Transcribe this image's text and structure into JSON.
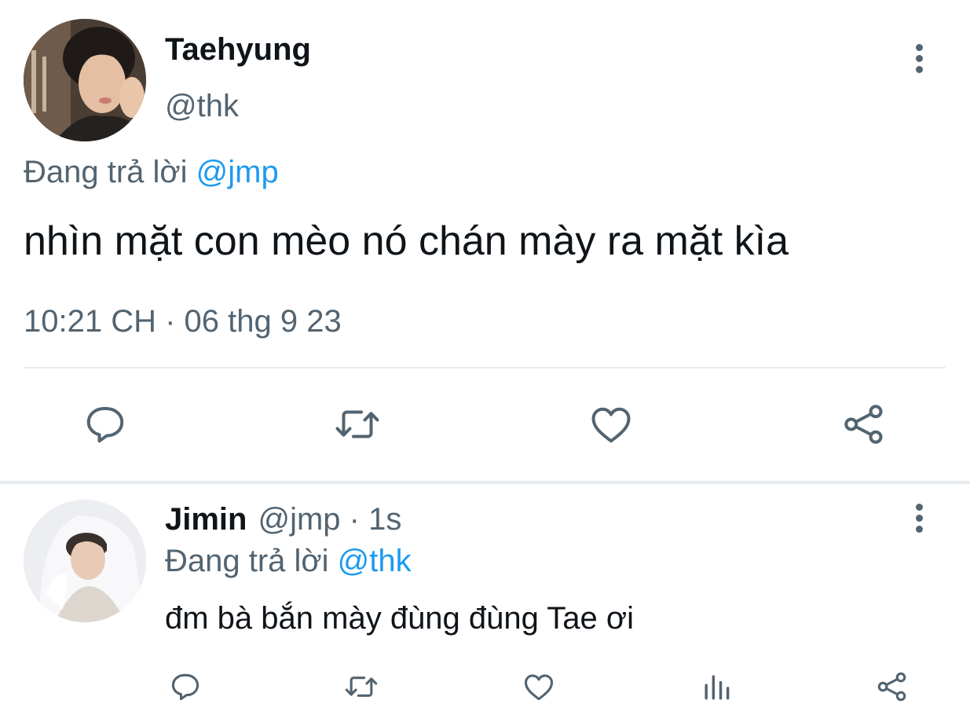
{
  "main_tweet": {
    "display_name": "Taehyung",
    "handle": "@thk",
    "replying_prefix": "Đang trả lời ",
    "replying_to": "@jmp",
    "text": "nhìn mặt con mèo nó chán mày ra mặt kìa",
    "timestamp": "10:21 CH · 06 thg 9 23",
    "icons": {
      "more": "more-vertical-icon",
      "reply": "reply-icon",
      "retweet": "retweet-icon",
      "like": "heart-icon",
      "share": "share-icon"
    }
  },
  "reply_tweet": {
    "display_name": "Jimin",
    "meta": "@jmp · 1s",
    "replying_prefix": "Đang trả lời ",
    "replying_to": "@thk",
    "text": "đm bà bắn mày đùng đùng Tae ơi",
    "icons": {
      "more": "more-vertical-icon",
      "reply": "reply-icon",
      "retweet": "retweet-icon",
      "like": "heart-icon",
      "stats": "analytics-icon",
      "share": "share-icon"
    }
  },
  "colors": {
    "text_primary": "#0f1419",
    "text_secondary": "#536471",
    "mention": "#1d9bf0",
    "divider": "#e6ecf0"
  }
}
